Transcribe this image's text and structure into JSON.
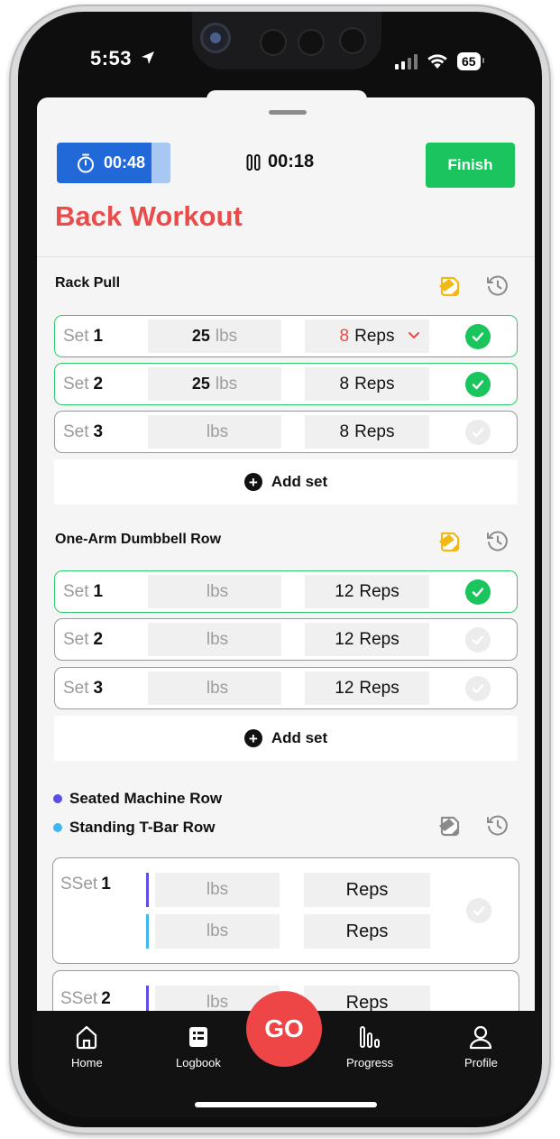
{
  "status": {
    "time": "5:53",
    "battery": "65"
  },
  "workout": {
    "rest_timer": "00:48",
    "elapsed": "00:18",
    "finish_label": "Finish",
    "title": "Back Workout",
    "rest_progress_fraction": 0.83
  },
  "exercises": [
    {
      "name": "Rack Pull",
      "sets": [
        {
          "label": "Set",
          "num": "1",
          "weight": "25",
          "unit": "lbs",
          "reps": "8",
          "reps_unit": "Reps",
          "done": true
        },
        {
          "label": "Set",
          "num": "2",
          "weight": "25",
          "unit": "lbs",
          "reps": "8",
          "reps_unit": "Reps",
          "done": true
        },
        {
          "label": "Set",
          "num": "3",
          "weight": "",
          "unit": "lbs",
          "reps": "8",
          "reps_unit": "Reps",
          "done": false
        }
      ],
      "add_set_label": "Add set"
    },
    {
      "name": "One-Arm Dumbbell Row",
      "sets": [
        {
          "label": "Set",
          "num": "1",
          "weight": "",
          "unit": "lbs",
          "reps": "12",
          "reps_unit": "Reps",
          "done": true
        },
        {
          "label": "Set",
          "num": "2",
          "weight": "",
          "unit": "lbs",
          "reps": "12",
          "reps_unit": "Reps",
          "done": false
        },
        {
          "label": "Set",
          "num": "3",
          "weight": "",
          "unit": "lbs",
          "reps": "12",
          "reps_unit": "Reps",
          "done": false
        }
      ],
      "add_set_label": "Add set"
    }
  ],
  "superset": {
    "exercises": [
      {
        "name": "Seated Machine Row",
        "color": "#5b4ee6"
      },
      {
        "name": "Standing T-Bar Row",
        "color": "#3fb6ef"
      }
    ],
    "sets": [
      {
        "label": "SSet",
        "num": "1",
        "unit_a": "lbs",
        "reps_a": "Reps",
        "unit_b": "lbs",
        "reps_b": "Reps"
      },
      {
        "label": "SSet",
        "num": "2",
        "unit_a": "lbs",
        "reps_a": "Reps"
      }
    ]
  },
  "colors": {
    "accent_red": "#ea4b4b",
    "done_green": "#19c55c",
    "timer_blue": "#2169d8",
    "note_yellow": "#f2b914"
  },
  "tabbar": {
    "home": "Home",
    "logbook": "Logbook",
    "go": "GO",
    "progress": "Progress",
    "profile": "Profile"
  }
}
